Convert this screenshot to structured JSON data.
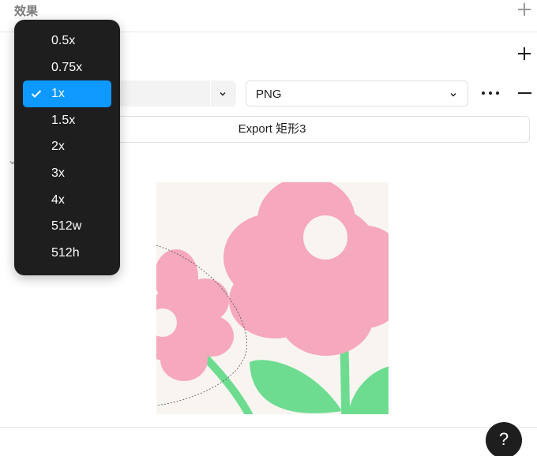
{
  "effects_section": {
    "title": "效果"
  },
  "export_settings": {
    "scale_value": "1x",
    "format_value": "PNG",
    "export_button_label": "Export 矩形3"
  },
  "scale_menu": {
    "items": [
      {
        "label": "0.5x",
        "selected": false
      },
      {
        "label": "0.75x",
        "selected": false
      },
      {
        "label": "1x",
        "selected": true
      },
      {
        "label": "1.5x",
        "selected": false
      },
      {
        "label": "2x",
        "selected": false
      },
      {
        "label": "3x",
        "selected": false
      },
      {
        "label": "4x",
        "selected": false
      },
      {
        "label": "512w",
        "selected": false
      },
      {
        "label": "512h",
        "selected": false
      }
    ]
  },
  "help": {
    "label": "?"
  },
  "colors": {
    "menu_bg": "#1e1e1e",
    "menu_selected": "#0d99ff",
    "petal_pink": "#f6a8bd",
    "leaf_green": "#6ddc90",
    "canvas_bg": "#f8f5f1"
  }
}
